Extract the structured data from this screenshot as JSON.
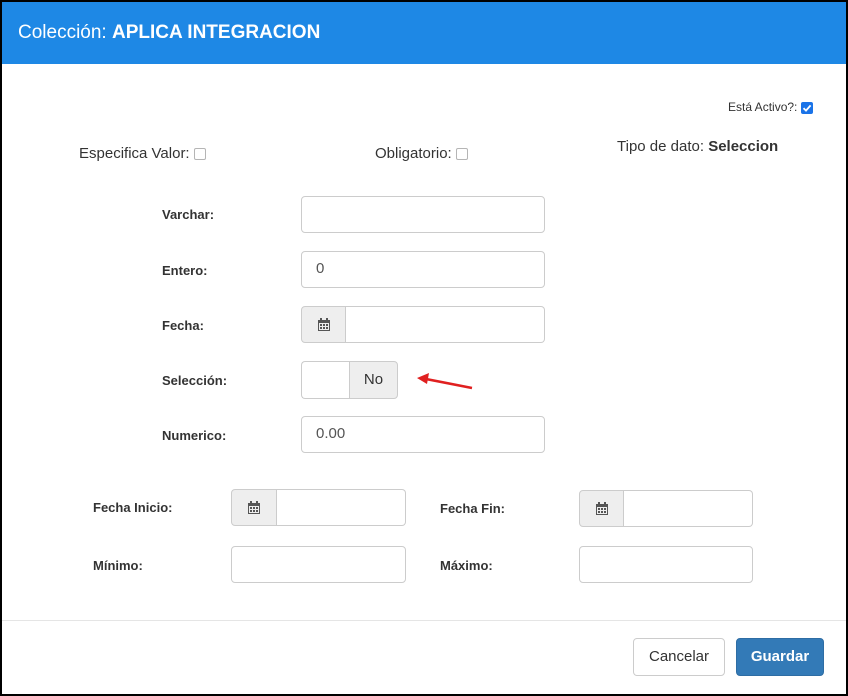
{
  "header": {
    "title_prefix": "Colección:",
    "title_value": "APLICA INTEGRACION",
    "bg_color": "#1e88e5"
  },
  "flags": {
    "activo_label": "Está Activo?:",
    "activo_checked": true,
    "especifica_label": "Especifica Valor:",
    "especifica_checked": false,
    "obligatorio_label": "Obligatorio:",
    "obligatorio_checked": false,
    "tipo_label": "Tipo de dato:",
    "tipo_value": "Seleccion"
  },
  "fields": {
    "varchar_label": "Varchar:",
    "varchar_value": "",
    "entero_label": "Entero:",
    "entero_value": "0",
    "fecha_label": "Fecha:",
    "fecha_value": "",
    "seleccion_label": "Selección:",
    "seleccion_value": "No",
    "numerico_label": "Numerico:",
    "numerico_value": "0.00"
  },
  "range": {
    "fecha_inicio_label": "Fecha Inicio:",
    "fecha_fin_label": "Fecha Fin:",
    "minimo_label": "Mínimo:",
    "maximo_label": "Máximo:"
  },
  "footer": {
    "cancel_label": "Cancelar",
    "save_label": "Guardar",
    "save_color": "#337ab7"
  },
  "annotation": {
    "arrow_color": "#e02020"
  }
}
